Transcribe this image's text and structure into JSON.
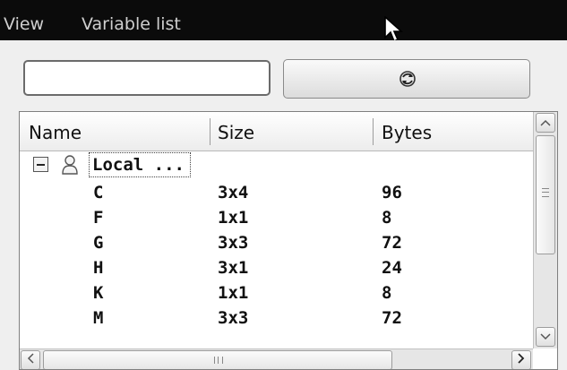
{
  "menubar": {
    "items": [
      "View",
      "Variable list"
    ]
  },
  "search": {
    "value": "",
    "placeholder": ""
  },
  "refresh_button": {
    "icon": "refresh-icon"
  },
  "table": {
    "columns": [
      "Name",
      "Size",
      "Bytes"
    ],
    "group": {
      "label": "Local ...",
      "icon": "user-icon"
    },
    "rows": [
      {
        "name": "C",
        "size": "3x4",
        "bytes": "96"
      },
      {
        "name": "F",
        "size": "1x1",
        "bytes": "8"
      },
      {
        "name": "G",
        "size": "3x3",
        "bytes": "72"
      },
      {
        "name": "H",
        "size": "3x1",
        "bytes": "24"
      },
      {
        "name": "K",
        "size": "1x1",
        "bytes": "8"
      },
      {
        "name": "M",
        "size": "3x3",
        "bytes": "72"
      }
    ]
  },
  "scrollbars": {
    "up": "^",
    "down": "v",
    "left": "<",
    "right": ">"
  },
  "colors": {
    "menubar_bg": "#0b0b0b",
    "menubar_text": "#cfcfcf",
    "panel_bg": "#efefef"
  }
}
